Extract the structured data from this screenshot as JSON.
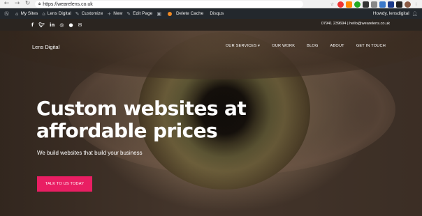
{
  "browser": {
    "url": "https://wearelens.co.uk",
    "icons": [
      "back-icon",
      "forward-icon",
      "reload-icon",
      "lock-icon",
      "star-icon"
    ]
  },
  "admin_bar": {
    "items": [
      {
        "icon": "wordpress-icon",
        "label": ""
      },
      {
        "icon": "my-sites-icon",
        "label": "My Sites"
      },
      {
        "icon": "site-icon",
        "label": "Lens Digital"
      },
      {
        "icon": "customize-icon",
        "label": "Customize"
      },
      {
        "icon": "plus-icon",
        "label": "New"
      },
      {
        "icon": "edit-icon",
        "label": "Edit Page"
      },
      {
        "icon": "plugin-icon",
        "label": ""
      },
      {
        "icon": "status-dot-icon",
        "label": "Delete Cache"
      },
      {
        "icon": "",
        "label": "Disqus"
      }
    ],
    "howdy": "Howdy, lensdigital"
  },
  "top_strip": {
    "social_icons": [
      "facebook-icon",
      "twitter-icon",
      "linkedin-icon",
      "instagram-icon",
      "github-icon",
      "email-icon"
    ],
    "contact": "07941 239694 | hello@wearelens.co.uk"
  },
  "header": {
    "logo": "Lens Digital",
    "nav": [
      "OUR SERVICES ▾",
      "OUR WORK",
      "BLOG",
      "ABOUT",
      "GET IN TOUCH"
    ]
  },
  "hero": {
    "headline_line1": "Custom websites at",
    "headline_line2": "affordable prices",
    "subline": "We build websites that build your business",
    "cta": "TALK TO US TODAY"
  },
  "colors": {
    "cta": "#e91e63",
    "admin_bar": "#23282d"
  }
}
